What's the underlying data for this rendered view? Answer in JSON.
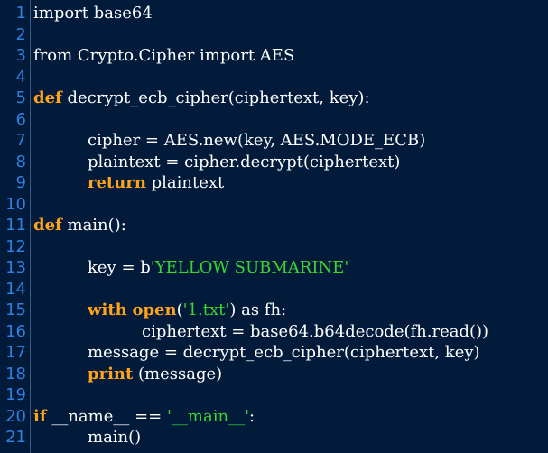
{
  "editor": {
    "language": "python",
    "colors": {
      "background": "#021b3b",
      "line_number": "#2f7fe0",
      "keyword": "#ffa318",
      "string": "#3ed42f",
      "text": "#ffffff"
    },
    "lines": [
      {
        "n": "1",
        "indent": "",
        "tokens": [
          {
            "t": "txt",
            "v": "import base64"
          }
        ]
      },
      {
        "n": "2",
        "indent": "",
        "tokens": []
      },
      {
        "n": "3",
        "indent": "",
        "tokens": [
          {
            "t": "txt",
            "v": "from Crypto.Cipher import AES"
          }
        ]
      },
      {
        "n": "4",
        "indent": "",
        "tokens": []
      },
      {
        "n": "5",
        "indent": "",
        "tokens": [
          {
            "t": "kw",
            "v": "def"
          },
          {
            "t": "txt",
            "v": " decrypt_ecb_cipher(ciphertext, key):"
          }
        ]
      },
      {
        "n": "6",
        "indent": "",
        "tokens": []
      },
      {
        "n": "7",
        "indent": "        ",
        "tokens": [
          {
            "t": "txt",
            "v": "cipher = AES.new(key, AES.MODE_ECB)"
          }
        ]
      },
      {
        "n": "8",
        "indent": "        ",
        "tokens": [
          {
            "t": "txt",
            "v": "plaintext = cipher.decrypt(ciphertext)"
          }
        ]
      },
      {
        "n": "9",
        "indent": "        ",
        "tokens": [
          {
            "t": "kw",
            "v": "return"
          },
          {
            "t": "txt",
            "v": " plaintext"
          }
        ]
      },
      {
        "n": "10",
        "indent": "",
        "tokens": []
      },
      {
        "n": "11",
        "indent": "",
        "tokens": [
          {
            "t": "kw",
            "v": "def"
          },
          {
            "t": "txt",
            "v": " main():"
          }
        ]
      },
      {
        "n": "12",
        "indent": "",
        "tokens": []
      },
      {
        "n": "13",
        "indent": "        ",
        "tokens": [
          {
            "t": "txt",
            "v": "key = b"
          },
          {
            "t": "str",
            "v": "'YELLOW SUBMARINE'"
          }
        ]
      },
      {
        "n": "14",
        "indent": "",
        "tokens": []
      },
      {
        "n": "15",
        "indent": "        ",
        "tokens": [
          {
            "t": "kw",
            "v": "with"
          },
          {
            "t": "txt",
            "v": " "
          },
          {
            "t": "kw",
            "v": "open"
          },
          {
            "t": "txt",
            "v": "("
          },
          {
            "t": "str",
            "v": "'1.txt'"
          },
          {
            "t": "txt",
            "v": ") as fh:"
          }
        ]
      },
      {
        "n": "16",
        "indent": "                ",
        "tokens": [
          {
            "t": "txt",
            "v": "ciphertext = base64.b64decode(fh.read())"
          }
        ]
      },
      {
        "n": "17",
        "indent": "        ",
        "tokens": [
          {
            "t": "txt",
            "v": "message = decrypt_ecb_cipher(ciphertext, key)"
          }
        ]
      },
      {
        "n": "18",
        "indent": "        ",
        "tokens": [
          {
            "t": "kw",
            "v": "print"
          },
          {
            "t": "txt",
            "v": " (message)"
          }
        ]
      },
      {
        "n": "19",
        "indent": "",
        "tokens": []
      },
      {
        "n": "20",
        "indent": "",
        "tokens": [
          {
            "t": "kw",
            "v": "if"
          },
          {
            "t": "txt",
            "v": " __name__ == "
          },
          {
            "t": "str",
            "v": "'__main__'"
          },
          {
            "t": "txt",
            "v": ":"
          }
        ]
      },
      {
        "n": "21",
        "indent": "        ",
        "tokens": [
          {
            "t": "txt",
            "v": "main()"
          }
        ]
      }
    ]
  }
}
